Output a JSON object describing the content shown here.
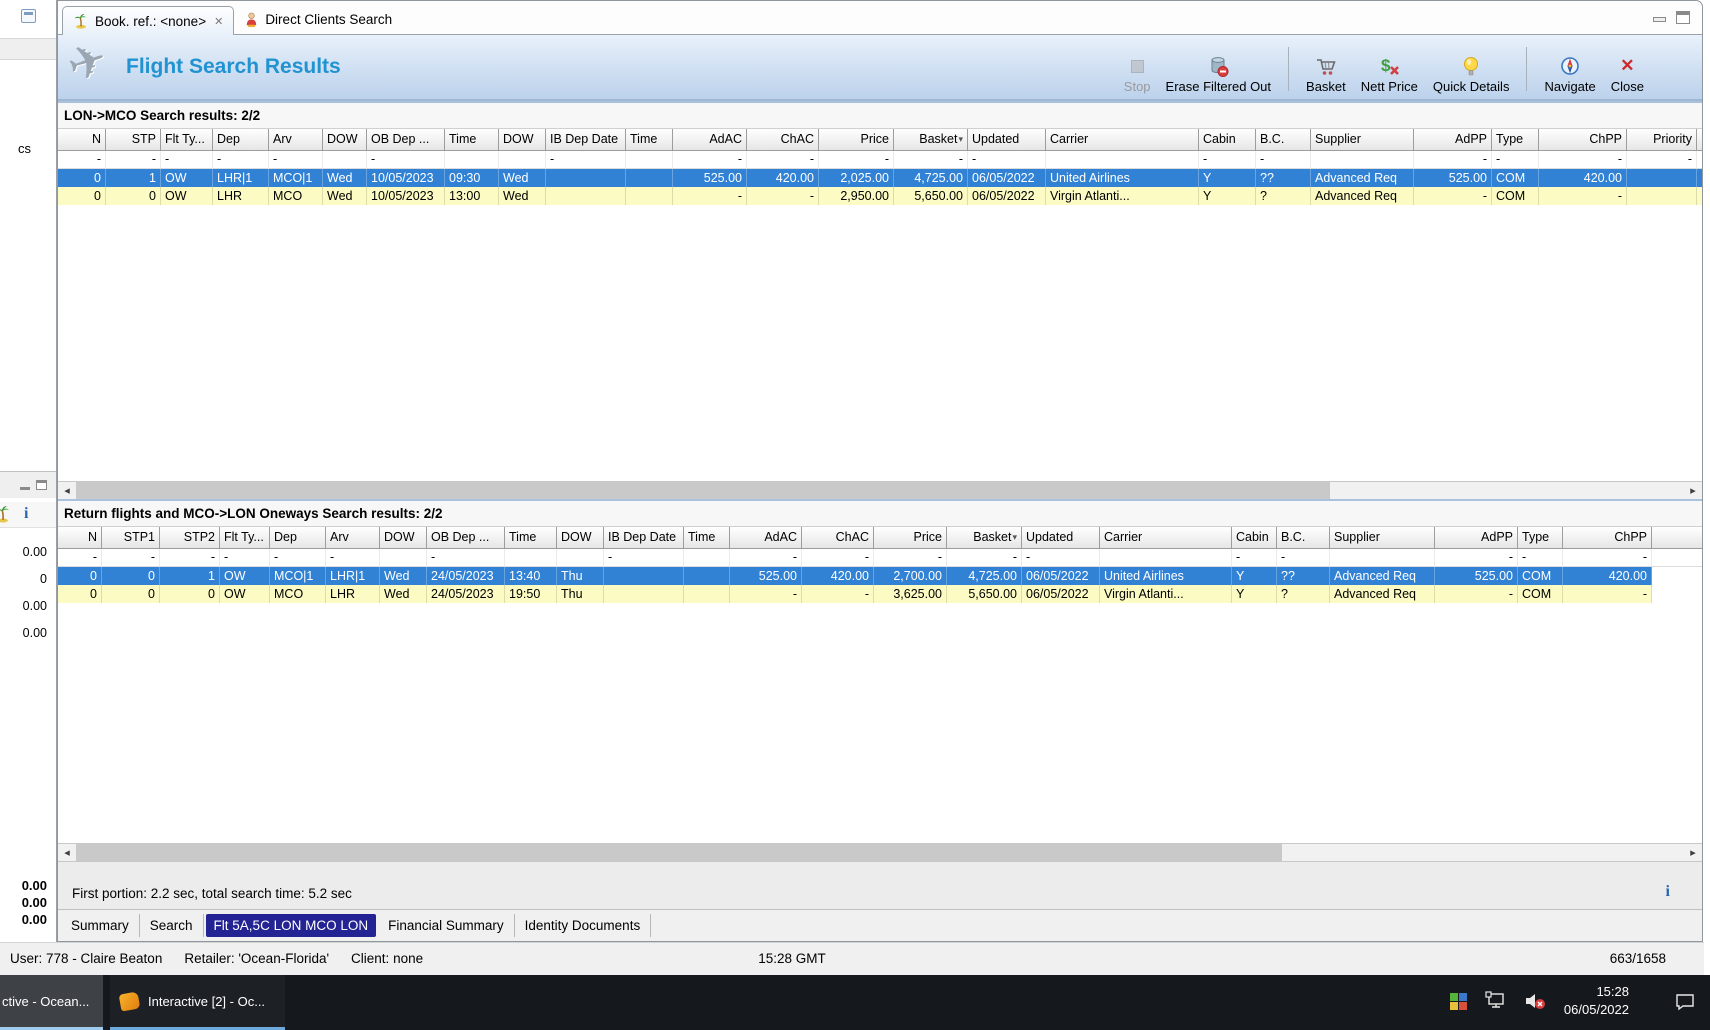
{
  "colors": {
    "selected_row": "#3182d4",
    "alt_row": "#fbfbc3",
    "selected_bottom_tab": "#232394",
    "banner_title": "#2193d1",
    "taskbar": "#15181c"
  },
  "icons": {
    "sort_desc": "▾",
    "scroll_left": "◂",
    "scroll_right": "▸",
    "tab_close": "✕",
    "toolbar_close": "✕",
    "info": "i",
    "names": [
      "palm-tree-icon",
      "person-icon",
      "airplane-icon",
      "stop-icon",
      "erase-db-icon",
      "basket-cart-icon",
      "nett-price-icon",
      "lightbulb-icon",
      "compass-icon",
      "close-x-icon",
      "avg-grid-icon",
      "network-icon",
      "speaker-muted-icon",
      "notification-bubble-icon"
    ]
  },
  "top_tabs": {
    "tab1": {
      "label": "Book. ref.: <none>"
    },
    "tab2": {
      "label": "Direct Clients Search"
    }
  },
  "banner": {
    "title": "Flight Search Results"
  },
  "toolbar": {
    "buttons": [
      {
        "label": "Stop",
        "enabled": false
      },
      {
        "label": "Erase Filtered Out",
        "enabled": true
      },
      {
        "label": "Basket",
        "enabled": true
      },
      {
        "label": "Nett Price",
        "enabled": true
      },
      {
        "label": "Quick Details",
        "enabled": true
      },
      {
        "label": "Navigate",
        "enabled": true
      },
      {
        "label": "Close",
        "enabled": true
      }
    ]
  },
  "outbound": {
    "title": "LON->MCO Search results: 2/2",
    "columns": [
      {
        "label": "N"
      },
      {
        "label": "STP"
      },
      {
        "label": "Flt Ty..."
      },
      {
        "label": "Dep"
      },
      {
        "label": "Arv"
      },
      {
        "label": "DOW"
      },
      {
        "label": "OB Dep ..."
      },
      {
        "label": "Time"
      },
      {
        "label": "DOW"
      },
      {
        "label": "IB Dep Date"
      },
      {
        "label": "Time"
      },
      {
        "label": "AdAC"
      },
      {
        "label": "ChAC"
      },
      {
        "label": "Price"
      },
      {
        "label": "Basket",
        "sort": "desc"
      },
      {
        "label": "Updated"
      },
      {
        "label": "Carrier"
      },
      {
        "label": "Cabin"
      },
      {
        "label": "B.C."
      },
      {
        "label": "Supplier"
      },
      {
        "label": "AdPP"
      },
      {
        "label": "Type"
      },
      {
        "label": "ChPP"
      },
      {
        "label": "Priority"
      }
    ],
    "filter": [
      "-",
      "-",
      "-",
      "-",
      "-",
      "",
      "-",
      "",
      "",
      "-",
      "",
      "-",
      "-",
      "-",
      "-",
      "-",
      "",
      "-",
      "-",
      "",
      "-",
      "-",
      "-",
      "-"
    ],
    "selected_index": 0,
    "rows": [
      [
        "0",
        "1",
        "OW",
        "LHR|1",
        "MCO|1",
        "Wed",
        "10/05/2023",
        "09:30",
        "Wed",
        "",
        "",
        "525.00",
        "420.00",
        "2,025.00",
        "4,725.00",
        "06/05/2022",
        "United Airlines",
        "Y",
        "??",
        "Advanced Req",
        "525.00",
        "COM",
        "420.00",
        ""
      ],
      [
        "0",
        "0",
        "OW",
        "LHR",
        "MCO",
        "Wed",
        "10/05/2023",
        "13:00",
        "Wed",
        "",
        "",
        "-",
        "-",
        "2,950.00",
        "5,650.00",
        "06/05/2022",
        "Virgin Atlanti...",
        "Y",
        "?",
        "Advanced Req",
        "-",
        "COM",
        "-",
        ""
      ]
    ]
  },
  "inbound": {
    "title": "Return flights and MCO->LON Oneways Search results: 2/2",
    "columns": [
      {
        "label": "N"
      },
      {
        "label": "STP1"
      },
      {
        "label": "STP2"
      },
      {
        "label": "Flt Ty..."
      },
      {
        "label": "Dep"
      },
      {
        "label": "Arv"
      },
      {
        "label": "DOW"
      },
      {
        "label": "OB Dep ..."
      },
      {
        "label": "Time"
      },
      {
        "label": "DOW"
      },
      {
        "label": "IB Dep Date"
      },
      {
        "label": "Time"
      },
      {
        "label": "AdAC"
      },
      {
        "label": "ChAC"
      },
      {
        "label": "Price"
      },
      {
        "label": "Basket",
        "sort": "desc"
      },
      {
        "label": "Updated"
      },
      {
        "label": "Carrier"
      },
      {
        "label": "Cabin"
      },
      {
        "label": "B.C."
      },
      {
        "label": "Supplier"
      },
      {
        "label": "AdPP"
      },
      {
        "label": "Type"
      },
      {
        "label": "ChPP"
      }
    ],
    "filter": [
      "-",
      "-",
      "-",
      "-",
      "-",
      "-",
      "",
      "-",
      "",
      "",
      "-",
      "",
      "-",
      "-",
      "-",
      "-",
      "-",
      "",
      "-",
      "-",
      "",
      "-",
      "-",
      "-"
    ],
    "selected_index": 0,
    "rows": [
      [
        "0",
        "0",
        "1",
        "OW",
        "MCO|1",
        "LHR|1",
        "Wed",
        "24/05/2023",
        "13:40",
        "Thu",
        "",
        "",
        "525.00",
        "420.00",
        "2,700.00",
        "4,725.00",
        "06/05/2022",
        "United Airlines",
        "Y",
        "??",
        "Advanced Req",
        "525.00",
        "COM",
        "420.00"
      ],
      [
        "0",
        "0",
        "0",
        "OW",
        "MCO",
        "LHR",
        "Wed",
        "24/05/2023",
        "19:50",
        "Thu",
        "",
        "",
        "-",
        "-",
        "3,625.00",
        "5,650.00",
        "06/05/2022",
        "Virgin Atlanti...",
        "Y",
        "?",
        "Advanced Req",
        "-",
        "COM",
        "-"
      ]
    ]
  },
  "footer": {
    "search_time": "First portion: 2.2 sec, total search time: 5.2 sec"
  },
  "bottom_tabs": {
    "items": [
      "Summary",
      "Search",
      "Flt 5A,5C LON MCO LON",
      "Financial Summary",
      "Identity Documents"
    ],
    "selected_index": 2
  },
  "status_bar": {
    "user": "User: 778 - Claire Beaton",
    "retailer": "Retailer: 'Ocean-Florida'",
    "client": "Client: none",
    "time": "15:28 GMT",
    "counter": "663/1658"
  },
  "left_panel": {
    "partial_label": "cs",
    "stats": [
      "0.00",
      "0",
      "0.00",
      "0.00"
    ],
    "totals": [
      "0.00",
      "0.00",
      "0.00"
    ]
  },
  "taskbar": {
    "buttons": [
      {
        "label": "ctive - Ocean..."
      },
      {
        "label": "Interactive [2] - Oc..."
      }
    ],
    "clock": {
      "time": "15:28",
      "date": "06/05/2022"
    }
  }
}
